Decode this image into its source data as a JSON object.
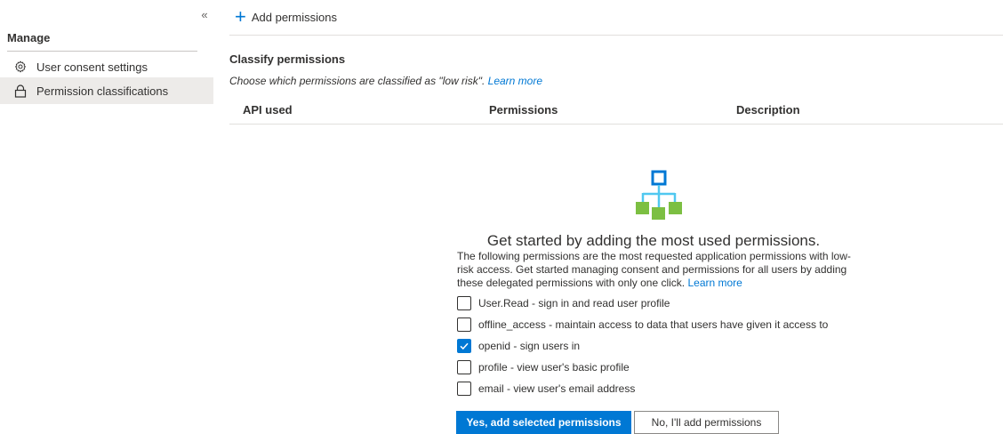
{
  "sidebar": {
    "collapse_glyph": "«",
    "manage_header": "Manage",
    "items": [
      {
        "label": "User consent settings",
        "icon": "gear-icon",
        "selected": false
      },
      {
        "label": "Permission classifications",
        "icon": "lock-icon",
        "selected": true
      }
    ]
  },
  "toolbar": {
    "add_permissions_label": "Add permissions",
    "add_icon": "plus-icon"
  },
  "section": {
    "title": "Classify permissions",
    "description": "Choose which permissions are classified as \"low risk\".",
    "learn_more": "Learn more"
  },
  "table": {
    "headers": [
      "API used",
      "Permissions",
      "Description"
    ]
  },
  "empty_state": {
    "icon": "hierarchy-icon",
    "title": "Get started by adding the most used permissions.",
    "description": "The following permissions are the most requested application permissions with low-risk access. Get started managing consent and permissions for all users by adding these delegated permissions with only one click.",
    "learn_more": "Learn more",
    "options": [
      {
        "label": "User.Read - sign in and read user profile",
        "checked": false
      },
      {
        "label": "offline_access - maintain access to data that users have given it access to",
        "checked": false
      },
      {
        "label": "openid - sign users in",
        "checked": true
      },
      {
        "label": "profile - view user's basic profile",
        "checked": false
      },
      {
        "label": "email - view user's email address",
        "checked": false
      }
    ],
    "primary_button": "Yes, add selected permissions",
    "secondary_button": "No, I'll add permissions"
  },
  "colors": {
    "accent": "#0078d4",
    "selected_nav_bg": "#edebe9",
    "icon_green": "#7cbf42",
    "icon_blue": "#0078d4",
    "icon_cyan": "#50c8f0"
  }
}
